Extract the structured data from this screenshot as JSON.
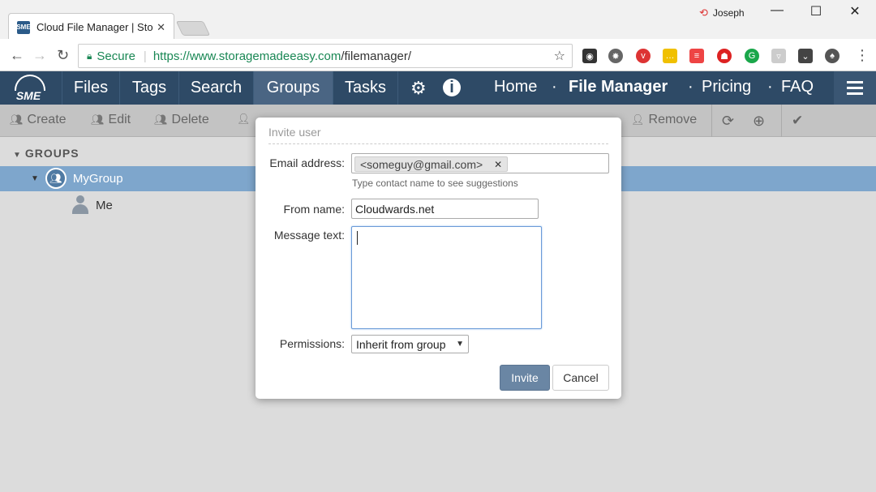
{
  "browser": {
    "tab_title": "Cloud File Manager | Stor",
    "tab_favicon": "SME",
    "user": "Joseph",
    "secure_label": "Secure",
    "url_base": "https://www.storagemadeeasy.com",
    "url_path": "/filemanager/"
  },
  "app": {
    "logo": "SME",
    "menu": [
      "Files",
      "Tags",
      "Search",
      "Groups",
      "Tasks"
    ],
    "active_menu": "Groups",
    "right_links": [
      "Home",
      "File Manager",
      "Pricing",
      "FAQ"
    ],
    "link_separator": "·"
  },
  "actions": {
    "create": "Create",
    "edit": "Edit",
    "delete": "Delete",
    "remove": "Remove"
  },
  "tree": {
    "heading": "GROUPS",
    "group": "MyGroup",
    "member": "Me"
  },
  "modal": {
    "title": "Invite user",
    "email_label": "Email address:",
    "email_chip": "<someguy@gmail.com>",
    "email_hint": "Type contact name to see suggestions",
    "from_label": "From name:",
    "from_value": "Cloudwards.net",
    "message_label": "Message text:",
    "message_value": "",
    "permissions_label": "Permissions:",
    "permissions_value": "Inherit from group",
    "invite_button": "Invite",
    "cancel_button": "Cancel"
  },
  "colors": {
    "nav_bg": "#2e4a66",
    "selection": "#7ea6cc",
    "invite_btn": "#6a86a4"
  }
}
